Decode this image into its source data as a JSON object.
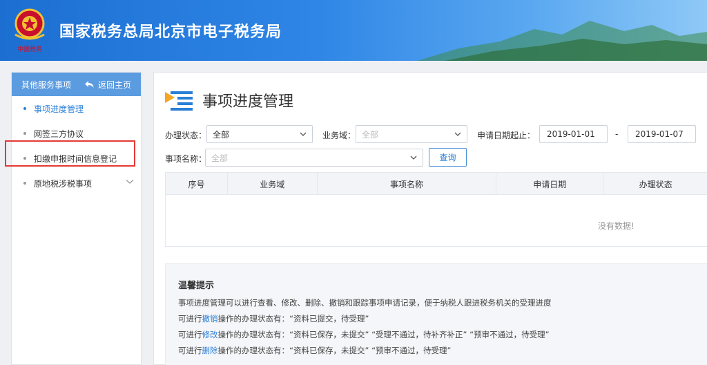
{
  "header": {
    "title": "国家税务总局北京市电子税务局"
  },
  "sidebar": {
    "head_label": "其他服务事项",
    "back_label": "返回主页",
    "items": [
      {
        "label": "事项进度管理"
      },
      {
        "label": "网签三方协议"
      },
      {
        "label": "扣缴申报时间信息登记"
      },
      {
        "label": "原地税涉税事项"
      }
    ]
  },
  "main": {
    "title": "事项进度管理",
    "filters": {
      "status_label": "办理状态：",
      "status_value": "全部",
      "domain_label": "业务域：",
      "domain_value": "全部",
      "date_label": "申请日期起止：",
      "date_from": "2019-01-01",
      "date_sep": "-",
      "date_to": "2019-01-07",
      "name_label": "事项名称：",
      "name_value": "全部",
      "query_label": "查询"
    },
    "table": {
      "columns": [
        "序号",
        "业务域",
        "事项名称",
        "申请日期",
        "办理状态"
      ],
      "empty_text": "没有数据!"
    },
    "tips": {
      "title": "温馨提示",
      "line1": "事项进度管理可以进行查看、修改、删除、撤销和跟踪事项申请记录，便于纳税人跟进税务机关的受理进度",
      "line2_pre": "可进行",
      "line2_action": "撤销",
      "line2_post": "操作的办理状态有：“资料已提交，待受理”",
      "line3_pre": "可进行",
      "line3_action": "修改",
      "line3_post": "操作的办理状态有：“资料已保存，未提交”   “受理不通过，待补齐补正”   “预审不通过，待受理”",
      "line4_pre": "可进行",
      "line4_action": "删除",
      "line4_post": "操作的办理状态有：“资料已保存，未提交”   “预审不通过，待受理”"
    }
  },
  "colors": {
    "header": "#2f86e6",
    "accent": "#2a7fd6",
    "sidebar_head": "#5b9be0",
    "highlight": "#e53935"
  },
  "icons": [
    "tax-emblem-icon",
    "back-arrow-icon",
    "chevron-down-icon",
    "page-title-icon",
    "caret-down-icon"
  ]
}
